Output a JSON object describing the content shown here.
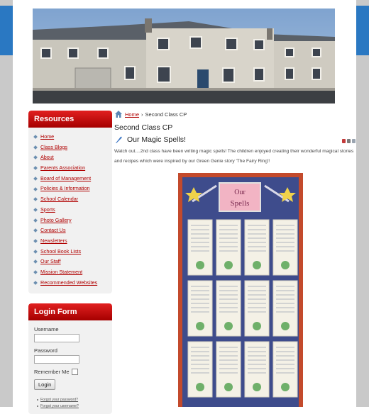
{
  "sidebar": {
    "resources_title": "Resources",
    "items": [
      {
        "label": "Home"
      },
      {
        "label": "Class Blogs"
      },
      {
        "label": "About"
      },
      {
        "label": "Parents Association"
      },
      {
        "label": "Board of Management"
      },
      {
        "label": "Policies & Information"
      },
      {
        "label": "School Calendar"
      },
      {
        "label": "Sports"
      },
      {
        "label": "Photo Gallery"
      },
      {
        "label": "Contact Us"
      },
      {
        "label": "Newsletters"
      },
      {
        "label": "School Book Lists"
      },
      {
        "label": "Our Staff"
      },
      {
        "label": "Mission Statement"
      },
      {
        "label": "Recommended Websites"
      }
    ]
  },
  "login": {
    "title": "Login Form",
    "username_label": "Username",
    "username_value": "",
    "password_label": "Password",
    "password_value": "",
    "remember_label": "Remember Me",
    "button_label": "Login",
    "forgot_password": "Forgot your password?",
    "forgot_username": "Forgot your username?"
  },
  "breadcrumb": {
    "home": "Home",
    "separator": "›",
    "current": "Second Class CP"
  },
  "content": {
    "category_title": "Second Class CP",
    "article_title": "Our Magic Spells!",
    "intro": "Watch out....2nd class have been writing magic spells! The children enjoyed creating their wonderful magical stories and recipes which were inspired by our Green Genie story 'The Fairy Ring'!"
  },
  "photo": {
    "sign_line1": "Our",
    "sign_line2": "Spells"
  },
  "colors": {
    "accent_red": "#c00000",
    "side_blue": "#2a78c2"
  },
  "icons": {
    "breadcrumb": "house-icon",
    "article": "quill-icon",
    "pdf": "pdf-icon",
    "print": "print-icon",
    "email": "email-icon"
  }
}
